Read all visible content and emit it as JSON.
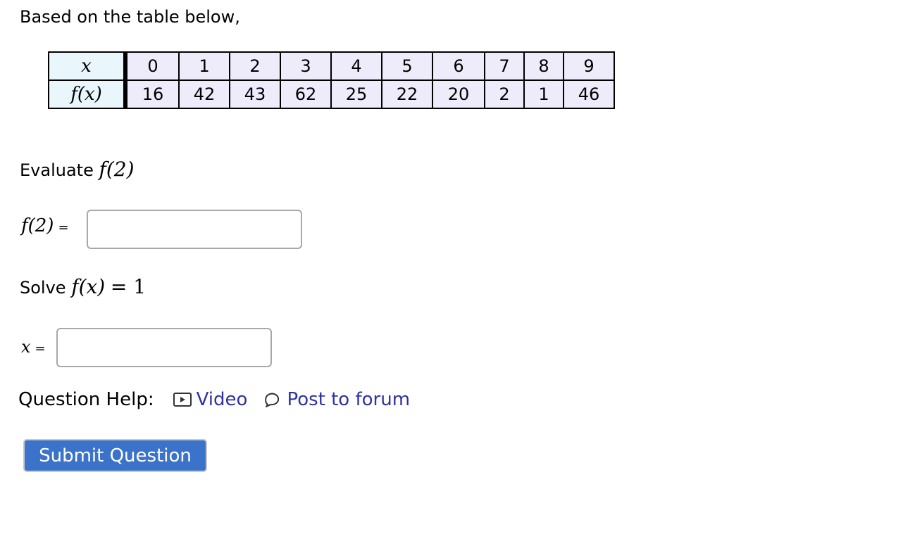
{
  "intro_text": "Based on the table below,",
  "table": {
    "row_headers": [
      "x",
      "f(x)"
    ],
    "x": [
      "0",
      "1",
      "2",
      "3",
      "4",
      "5",
      "6",
      "7",
      "8",
      "9"
    ],
    "fx": [
      "16",
      "42",
      "43",
      "62",
      "25",
      "22",
      "20",
      "2",
      "1",
      "46"
    ],
    "colors": {
      "header_bg": "#e9f6fb",
      "cell_bg": "#eeecfa"
    }
  },
  "part1": {
    "prompt_text": "Evaluate",
    "prompt_math": "f(2)",
    "answer_label": "f(2)",
    "equals": "=",
    "answer_value": ""
  },
  "part2": {
    "prompt_text": "Solve",
    "prompt_math_f": "f(x)",
    "prompt_math_rhs": "= 1",
    "answer_label": "x",
    "equals": "=",
    "answer_value": ""
  },
  "help": {
    "label": "Question Help:",
    "video_label": "Video",
    "video_icon": "video-play-icon",
    "forum_label": "Post to forum",
    "forum_icon": "speech-bubble-icon",
    "link_color": "#2e32a6"
  },
  "submit": {
    "label": "Submit Question",
    "color": "#3a73c9"
  }
}
